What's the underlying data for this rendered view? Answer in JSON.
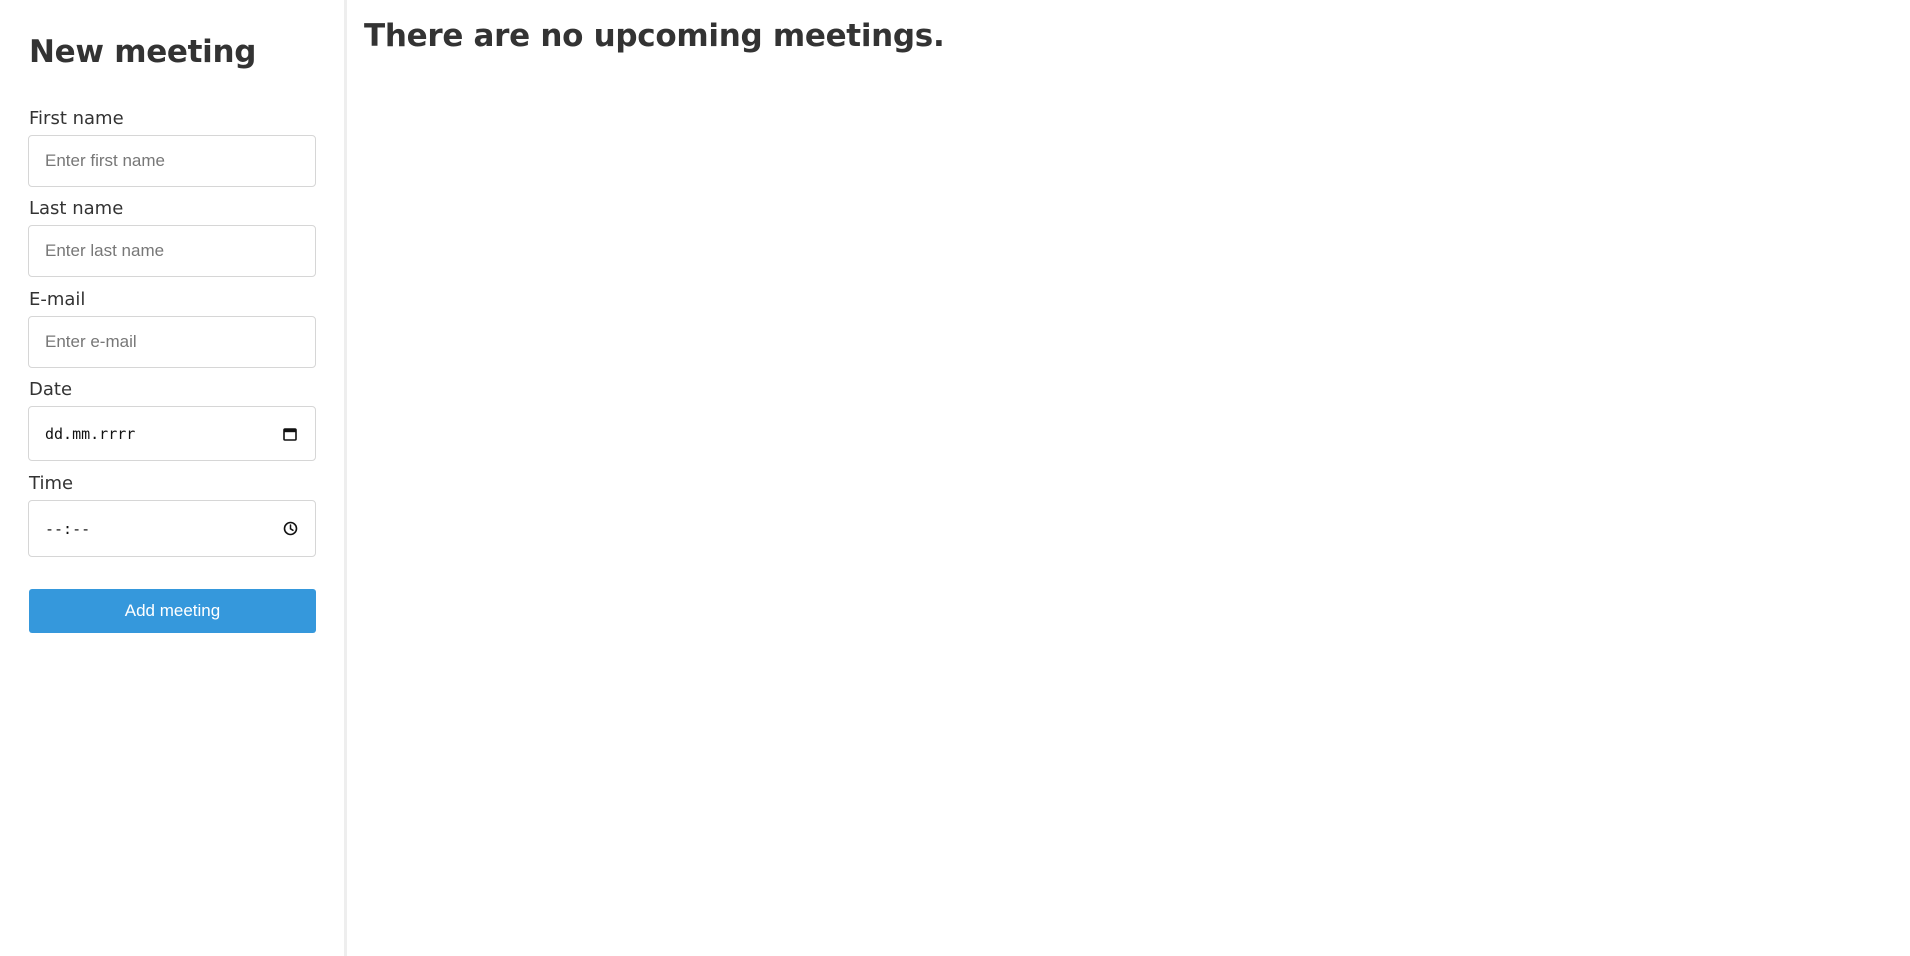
{
  "form": {
    "title": "New meeting",
    "first_name": {
      "label": "First name",
      "placeholder": "Enter first name"
    },
    "last_name": {
      "label": "Last name",
      "placeholder": "Enter last name"
    },
    "email": {
      "label": "E-mail",
      "placeholder": "Enter e-mail"
    },
    "date": {
      "label": "Date",
      "value": "dd.mm.rrrr",
      "icon": "calendar-icon"
    },
    "time": {
      "label": "Time",
      "value": "--:--",
      "icon": "clock-icon"
    },
    "submit_label": "Add meeting"
  },
  "main": {
    "message": "There are no upcoming meetings."
  },
  "colors": {
    "accent": "#3598dc",
    "text": "#333333",
    "divider": "#eeeeee"
  }
}
